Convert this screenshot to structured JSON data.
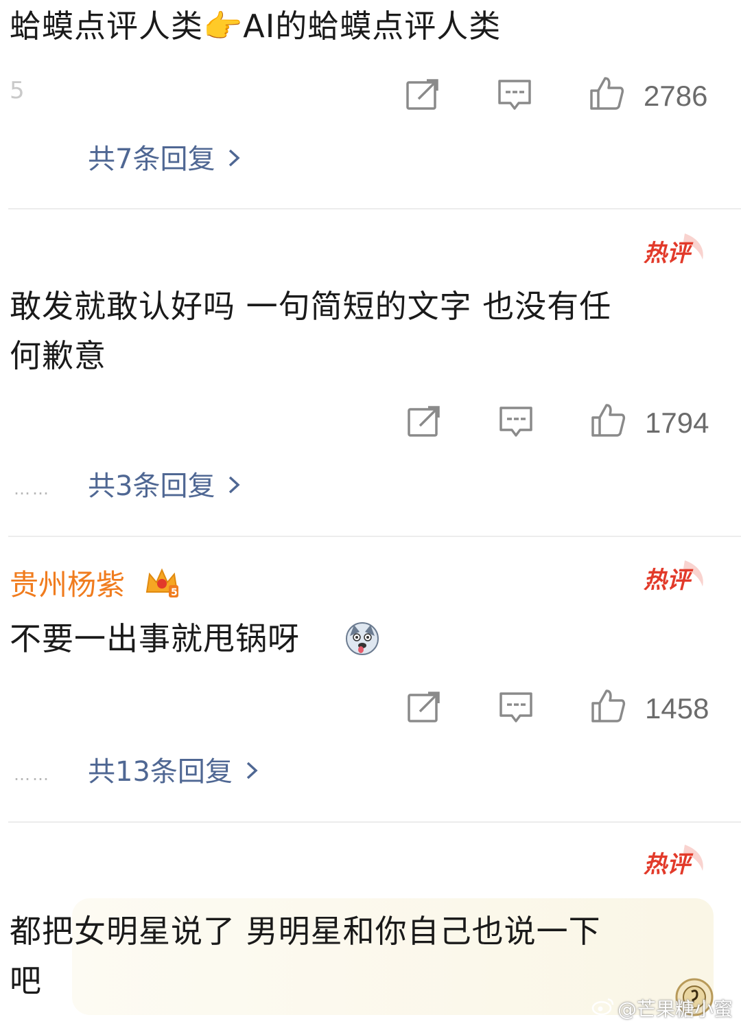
{
  "comments": [
    {
      "text": "蛤蟆点评人类👉AI的蛤蟆点评人类",
      "meta_fragment_a": "5",
      "meta_fragment_b": "",
      "likes": "2786",
      "replies_label": "共7条回复"
    },
    {
      "username_fragment": "",
      "hot_label": "热评",
      "text_line1": "敢发就敢认好吗 一句简短的文字 也没有任",
      "text_line2": "何歉意",
      "likes": "1794",
      "replies_label": "共3条回复",
      "reply_dots": "……"
    },
    {
      "username": "贵州杨紫",
      "hot_label": "热评",
      "text": "不要一出事就甩锅呀",
      "likes": "1458",
      "replies_label": "共13条回复",
      "reply_dots": "……"
    },
    {
      "hot_label": "热评",
      "text_line1": "都把女明星说了 男明星和你自己也说一下",
      "text_line2": "吧"
    }
  ],
  "icons": {
    "share": "share-icon",
    "comment": "comment-icon",
    "like": "like-icon",
    "reply_arrow": "chevron-right-icon",
    "crown": "vip-crown-icon",
    "emoji": "husky-emoji-icon"
  },
  "watermark": "@芒果糖小蜜",
  "colors": {
    "reply_link": "#4f6793",
    "username": "#f07c1e",
    "hot_badge": "#e23a2a",
    "icon_gray": "#8a8a8a"
  }
}
